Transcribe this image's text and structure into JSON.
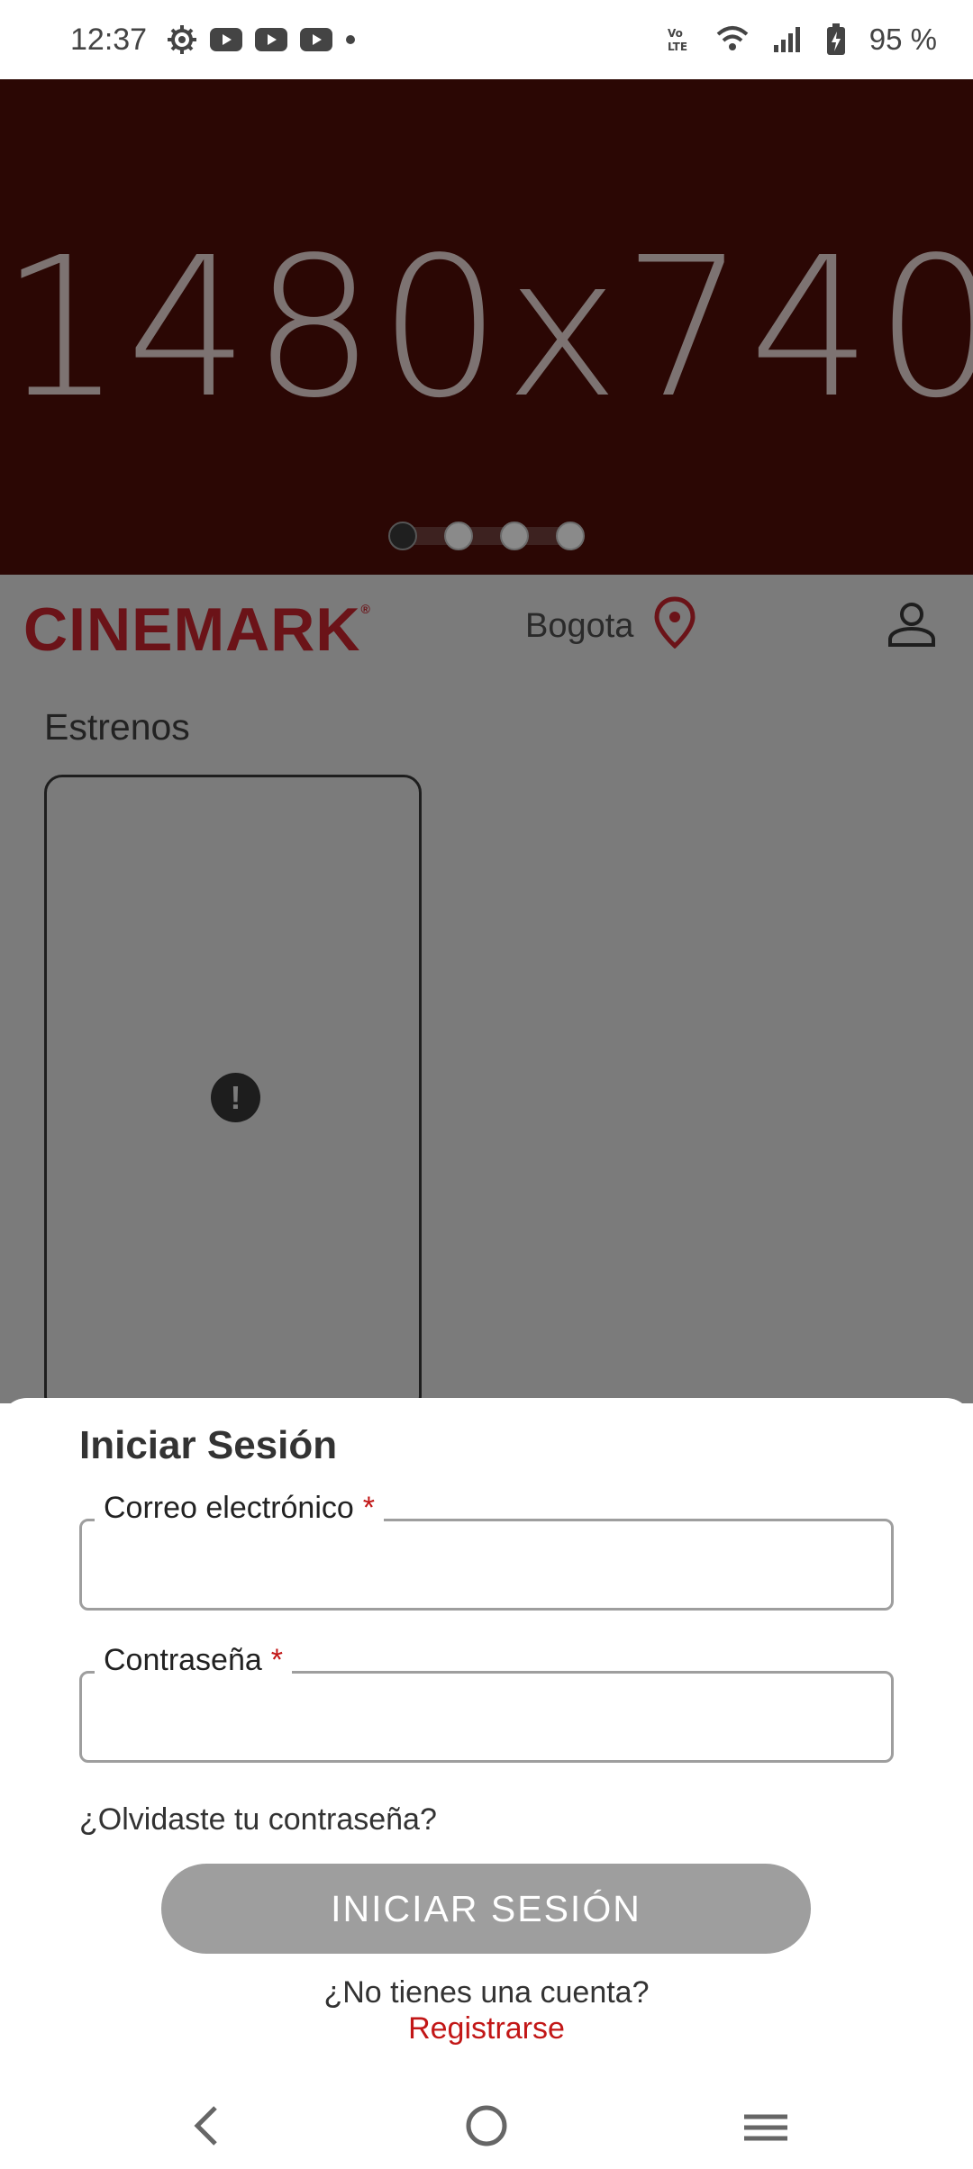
{
  "status_bar": {
    "time": "12:37",
    "battery": "95 %",
    "icons": [
      "settings-icon",
      "youtube-icon",
      "youtube-icon",
      "youtube-icon",
      "notification-dot-icon",
      "volte-icon",
      "wifi-icon",
      "signal-icon",
      "battery-icon"
    ]
  },
  "banner": {
    "placeholder_text": "1480x740",
    "slide_count": 4,
    "active_slide": 1
  },
  "header": {
    "logo": "CINEMARK",
    "logo_mark": "®",
    "city": "Bogota"
  },
  "main": {
    "section_title": "Estrenos",
    "error_glyph": "!"
  },
  "login_sheet": {
    "title": "Iniciar Sesión",
    "email_label": "Correo electrónico",
    "password_label": "Contraseña",
    "required_mark": "*",
    "email_value": "",
    "password_value": "",
    "forgot_password": "¿Olvidaste tu contraseña?",
    "login_button": "INICIAR SESIÓN",
    "no_account": "¿No tienes una cuenta?",
    "register_link": "Registrarse"
  },
  "colors": {
    "brand_red": "#6b1318",
    "link_red": "#c21717",
    "banner_bg": "#2b0704",
    "overlay_gray": "#7b7b7b",
    "button_disabled": "#9e9e9e"
  }
}
